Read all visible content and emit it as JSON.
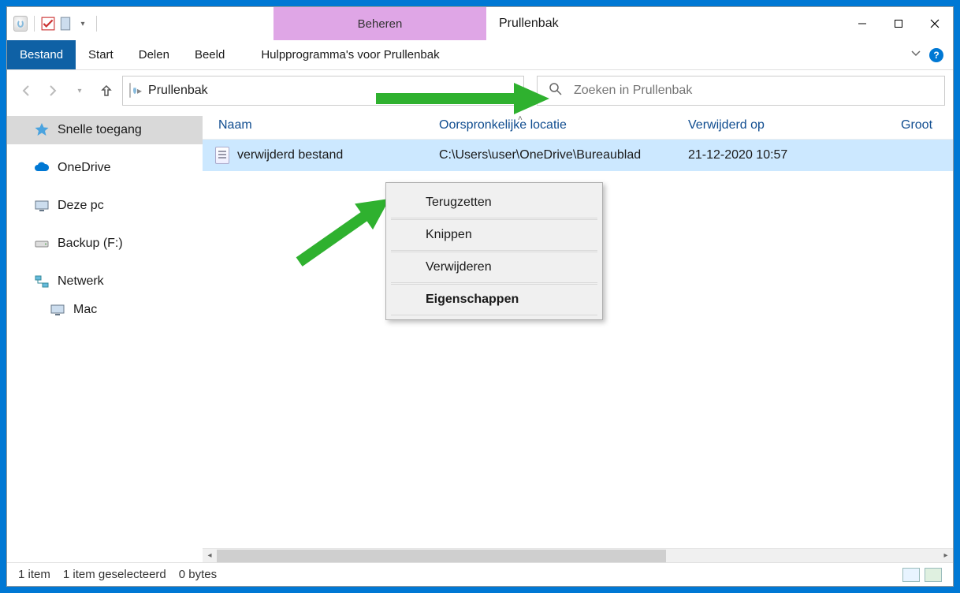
{
  "titlebar": {
    "context_tab": "Beheren",
    "title": "Prullenbak"
  },
  "ribbon": {
    "file": "Bestand",
    "tabs": [
      "Start",
      "Delen",
      "Beeld"
    ],
    "contextual": "Hulpprogramma's voor Prullenbak"
  },
  "address": {
    "crumb": "Prullenbak"
  },
  "search": {
    "placeholder": "Zoeken in Prullenbak"
  },
  "sidebar": {
    "items": [
      {
        "label": "Snelle toegang",
        "icon": "star",
        "selected": true
      },
      {
        "label": "OneDrive",
        "icon": "cloud"
      },
      {
        "label": "Deze pc",
        "icon": "pc"
      },
      {
        "label": "Backup (F:)",
        "icon": "drive"
      },
      {
        "label": "Netwerk",
        "icon": "network"
      },
      {
        "label": "Mac",
        "icon": "pc",
        "nested": true
      }
    ]
  },
  "columns": {
    "name": "Naam",
    "loc": "Oorspronkelijke locatie",
    "del": "Verwijderd op",
    "size": "Groot"
  },
  "rows": [
    {
      "name": "verwijderd bestand",
      "loc": "C:\\Users\\user\\OneDrive\\Bureaublad",
      "del": "21-12-2020 10:57"
    }
  ],
  "context_menu": [
    {
      "label": "Terugzetten"
    },
    {
      "label": "Knippen"
    },
    {
      "label": "Verwijderen"
    },
    {
      "label": "Eigenschappen",
      "bold": true
    }
  ],
  "status": {
    "count": "1 item",
    "selected": "1 item geselecteerd",
    "size": "0 bytes"
  }
}
